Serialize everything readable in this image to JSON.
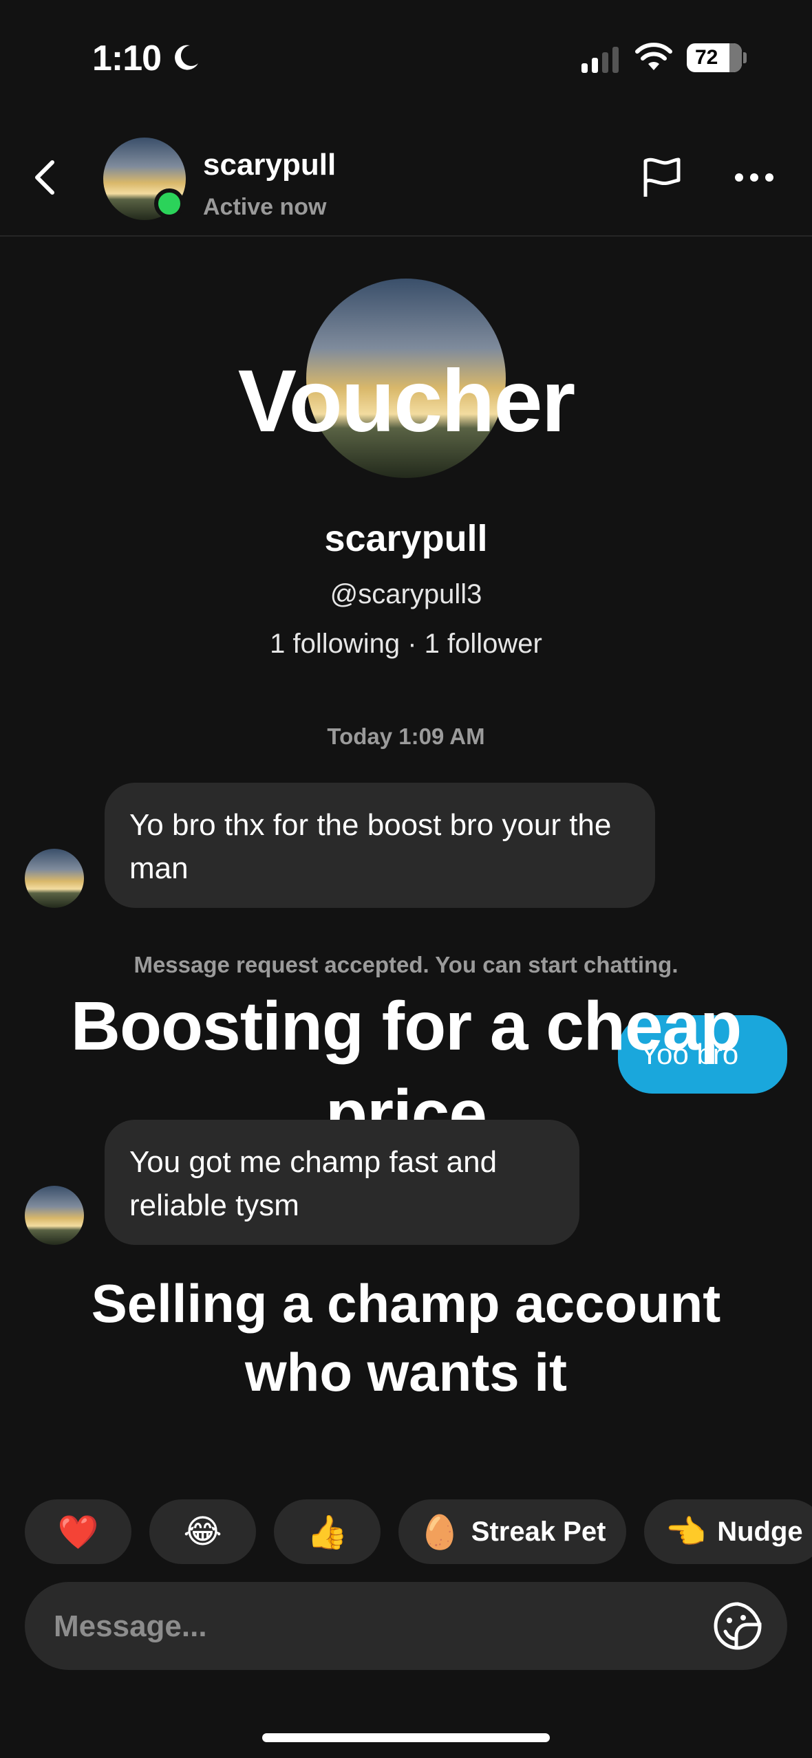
{
  "status_bar": {
    "time": "1:10",
    "battery": "72"
  },
  "header": {
    "back_icon": "chevron-left-icon",
    "username": "scarypull",
    "status": "Active now"
  },
  "profile": {
    "overlay_text": "Voucher",
    "name": "scarypull",
    "handle": "@scarypull3",
    "follow_stats": "1 following · 1 follower"
  },
  "timestamp": "Today 1:09 AM",
  "messages": {
    "first_incoming": "Yo bro thx for the boost bro your the man",
    "system_note": "Message request accepted. You can start chatting.",
    "outgoing": "Yoo bro",
    "second_incoming": "You got me champ fast and reliable tysm"
  },
  "overlays": {
    "boosting": "Boosting for a cheap price",
    "selling": "Selling a champ account who wants it"
  },
  "reactions": [
    {
      "glyph": "❤️",
      "label": ""
    },
    {
      "glyph": "😂",
      "label": ""
    },
    {
      "glyph": "👍",
      "label": ""
    },
    {
      "glyph": "🥚",
      "label": "Streak Pet"
    },
    {
      "glyph": "👈",
      "label": "Nudge"
    }
  ],
  "composer": {
    "placeholder": "Message..."
  },
  "colors": {
    "background": "#121212",
    "bubble_in": "#2a2a2a",
    "bubble_out": "#1aa7dc",
    "online": "#2bd35a"
  }
}
